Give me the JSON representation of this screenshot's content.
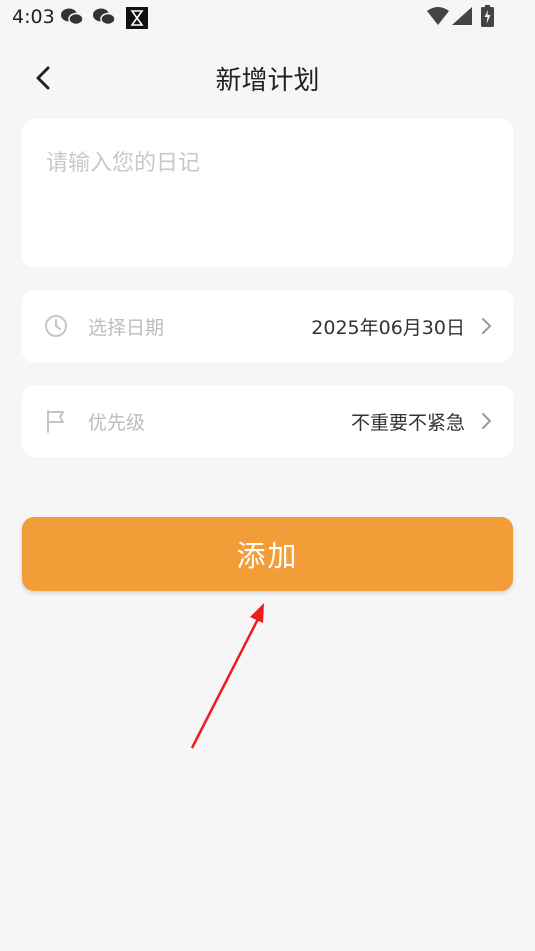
{
  "status_bar": {
    "time": "4:03",
    "left_icons": [
      "wechat-icon",
      "wechat-icon",
      "hourglass-icon"
    ],
    "right_icons": [
      "wifi-icon",
      "signal-icon",
      "battery-icon"
    ]
  },
  "nav": {
    "title": "新增计划",
    "back_icon": "chevron-left-icon"
  },
  "diary": {
    "placeholder": "请输入您的日记",
    "value": ""
  },
  "date_row": {
    "icon": "clock-icon",
    "label": "选择日期",
    "value": "2025年06月30日"
  },
  "priority_row": {
    "icon": "flag-icon",
    "label": "优先级",
    "value": "不重要不紧急"
  },
  "add_button": {
    "label": "添加",
    "color": "#f29d38"
  },
  "annotation": {
    "arrow_color": "#ee1c1c"
  }
}
